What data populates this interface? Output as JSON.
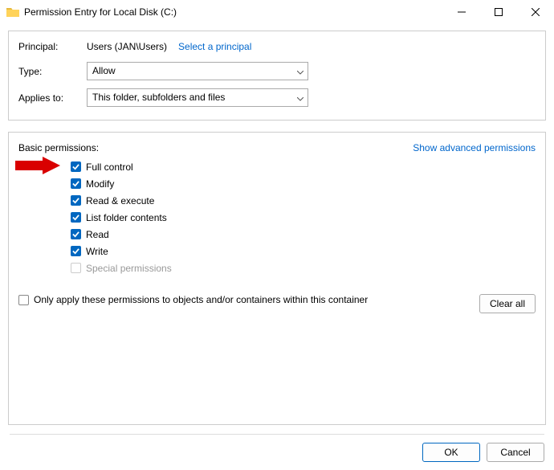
{
  "window": {
    "title": "Permission Entry for Local Disk (C:)"
  },
  "top": {
    "principal_label": "Principal:",
    "principal_value": "Users (JAN\\Users)",
    "select_principal": "Select a principal",
    "type_label": "Type:",
    "type_value": "Allow",
    "applies_label": "Applies to:",
    "applies_value": "This folder, subfolders and files"
  },
  "perms": {
    "header": "Basic permissions:",
    "show_advanced": "Show advanced permissions",
    "items": [
      {
        "label": "Full control",
        "checked": true,
        "enabled": true
      },
      {
        "label": "Modify",
        "checked": true,
        "enabled": true
      },
      {
        "label": "Read & execute",
        "checked": true,
        "enabled": true
      },
      {
        "label": "List folder contents",
        "checked": true,
        "enabled": true
      },
      {
        "label": "Read",
        "checked": true,
        "enabled": true
      },
      {
        "label": "Write",
        "checked": true,
        "enabled": true
      },
      {
        "label": "Special permissions",
        "checked": false,
        "enabled": false
      }
    ],
    "only_apply": "Only apply these permissions to objects and/or containers within this container",
    "only_apply_checked": false,
    "clear_all": "Clear all"
  },
  "footer": {
    "ok": "OK",
    "cancel": "Cancel"
  }
}
